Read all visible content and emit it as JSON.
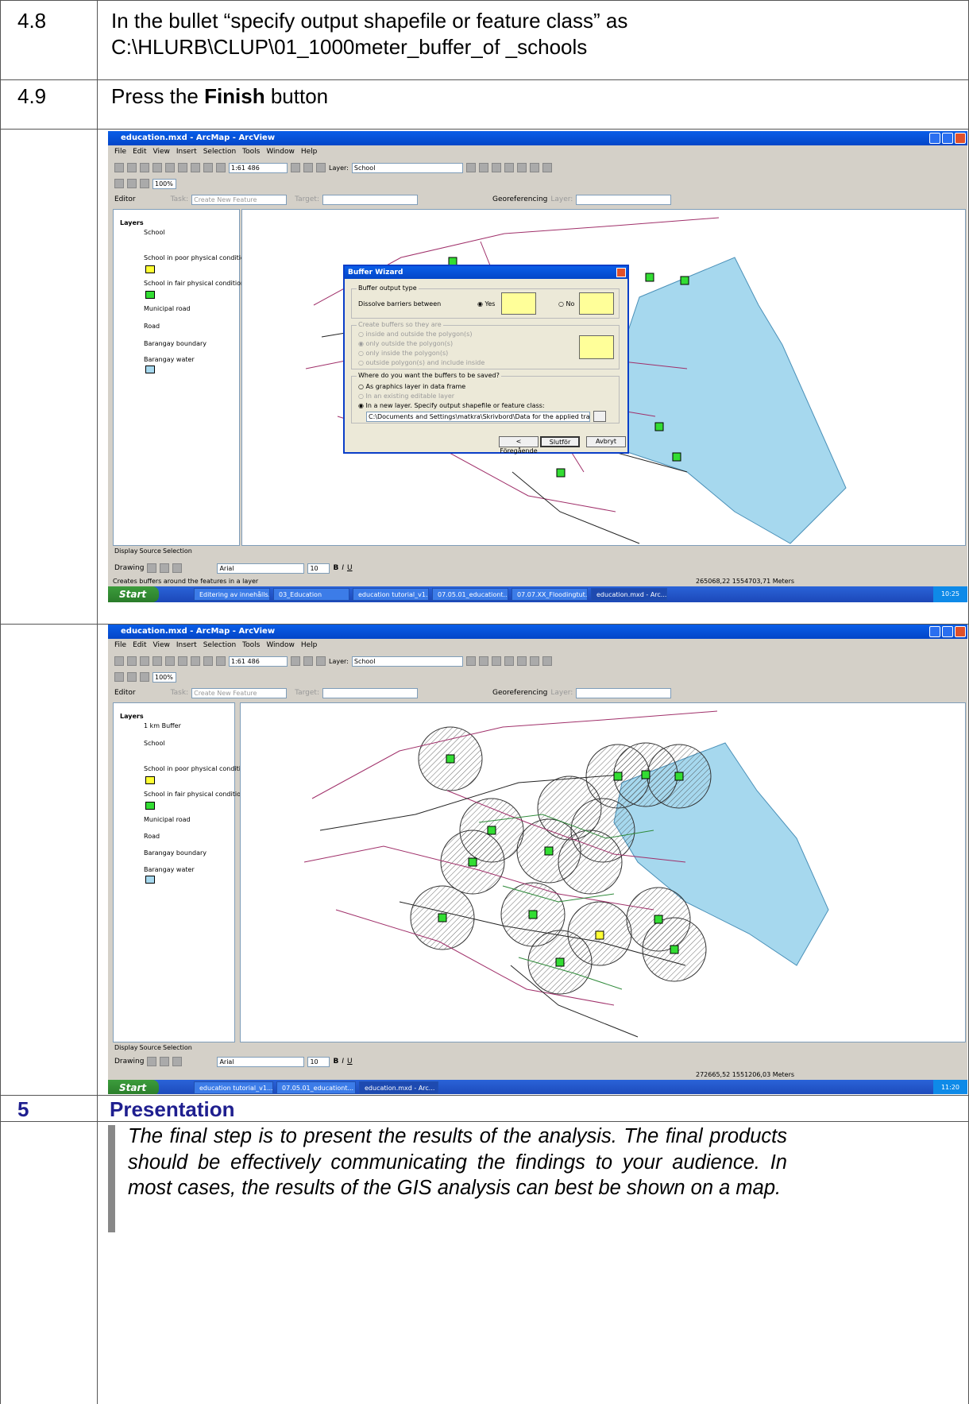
{
  "rows": [
    {
      "step": "4.8",
      "text_line1": "In the bullet “specify output shapefile or feature class” as",
      "text_line2": "C:\\HLURB\\CLUP\\01_1000meter_buffer_of _schools"
    },
    {
      "step": "4.9",
      "text_pre": "Press the ",
      "text_bold": "Finish",
      "text_post": " button"
    }
  ],
  "screenshot1": {
    "window_title": "education.mxd - ArcMap - ArcView",
    "menu": [
      "File",
      "Edit",
      "View",
      "Insert",
      "Selection",
      "Tools",
      "Window",
      "Help"
    ],
    "scale": "1:61 486",
    "layer_label": "Layer:",
    "layer_value": "School",
    "zoom": "100%",
    "editor": "Editor",
    "task_label": "Task:",
    "task_value": "Create New Feature",
    "target_label": "Target:",
    "georef": "Georeferencing",
    "layer2_label": "Layer:",
    "toc_root": "Layers",
    "toc_items": [
      "School",
      "School in poor physical condition",
      "School in fair physical condition",
      "Municipal road",
      "Road",
      "Barangay boundary",
      "Barangay water"
    ],
    "toc_tabs": [
      "Display",
      "Source",
      "Selection"
    ],
    "drawing": "Drawing",
    "font": "Arial",
    "fontsize": "10",
    "status_left": "Creates buffers around the features in a layer",
    "status_right": "265068,22  1554703,71 Meters",
    "start": "Start",
    "tasks": [
      "Editering av innehålls...",
      "03_Education",
      "education tutorial_v1...",
      "07.05.01_educationt...",
      "07.07.XX_Floodingtut...",
      "education.mxd - Arc..."
    ],
    "clock": "10:25",
    "dialog": {
      "title": "Buffer Wizard",
      "group1": "Buffer output type",
      "dissolve": "Dissolve barriers between",
      "yes": "Yes",
      "no": "No",
      "group2": "Create buffers so they are",
      "opts2": [
        "inside and outside the polygon(s)",
        "only outside the polygon(s)",
        "only inside the polygon(s)",
        "outside polygon(s) and include inside"
      ],
      "group3": "Where do you want the buffers to be saved?",
      "opts3": [
        "As graphics layer in data frame",
        "In an existing editable layer",
        "In a new layer.  Specify output shapefile or feature class:"
      ],
      "path": "C:\\Documents and Settings\\matkra\\Skrivbord\\Data for the applied training\\övriga områ",
      "back": "< Föregående",
      "finish": "Slutför",
      "cancel": "Avbryt"
    }
  },
  "screenshot2": {
    "window_title": "education.mxd - ArcMap - ArcView",
    "menu": [
      "File",
      "Edit",
      "View",
      "Insert",
      "Selection",
      "Tools",
      "Window",
      "Help"
    ],
    "scale": "1:61 486",
    "layer_label": "Layer:",
    "layer_value": "School",
    "zoom": "100%",
    "editor": "Editor",
    "task_label": "Task:",
    "task_value": "Create New Feature",
    "target_label": "Target:",
    "georef": "Georeferencing",
    "layer2_label": "Layer:",
    "toc_root": "Layers",
    "toc_items": [
      "1 km Buffer",
      "School",
      "School in poor physical condition",
      "School in fair physical condition",
      "Municipal road",
      "Road",
      "Barangay boundary",
      "Barangay water"
    ],
    "toc_tabs": [
      "Display",
      "Source",
      "Selection"
    ],
    "drawing": "Drawing",
    "font": "Arial",
    "fontsize": "10",
    "status_right": "272665,52  1551206,03 Meters",
    "start": "Start",
    "tasks": [
      "education tutorial_v1...",
      "07.05.01_educationt...",
      "education.mxd - Arc..."
    ],
    "clock": "11:20"
  },
  "section": {
    "number": "5",
    "title": "Presentation"
  },
  "quote": "The final step is to present the results of the analysis. The final products should be effectively communicating the findings to your audience. In most cases, the results of the GIS analysis can best be shown on a map.",
  "colors": {
    "section_title": "#1f1f8f",
    "water": "#a6d8ee",
    "yellow_school": "#ffff33",
    "green_school": "#33dd33"
  }
}
